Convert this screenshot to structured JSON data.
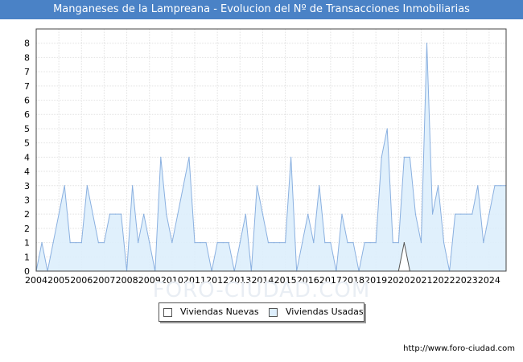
{
  "title": "Manganeses de la Lampreana - Evolucion del Nº de Transacciones Inmobiliarias",
  "watermark": "FORO-CIUDAD.COM",
  "footer_url": "http://www.foro-ciudad.com",
  "colors": {
    "title_bg": "#4a82c6",
    "usadas_fill": "#ddeefc",
    "usadas_line": "#8ab0e0",
    "nuevas_fill": "#ffffff",
    "nuevas_line": "#555555"
  },
  "legend": [
    {
      "label": "Viviendas Nuevas",
      "color": "#ffffff"
    },
    {
      "label": "Viviendas Usadas",
      "color": "#ddeefc"
    }
  ],
  "chart_data": {
    "type": "area",
    "title": "Manganeses de la Lampreana - Evolucion del Nº de Transacciones Inmobiliarias",
    "xlabel": "",
    "ylabel": "",
    "x_tick_labels": [
      "2004",
      "2005",
      "2006",
      "2007",
      "2008",
      "2009",
      "2010",
      "2011",
      "2012",
      "2013",
      "2014",
      "2015",
      "2016",
      "2017",
      "2018",
      "2019",
      "2020",
      "2021",
      "2022",
      "2023",
      "2024"
    ],
    "y_tick_labels": [
      "0",
      "1",
      "1",
      "2",
      "2",
      "3",
      "3",
      "4",
      "4",
      "5",
      "5",
      "6",
      "6",
      "7",
      "7",
      "8",
      "8"
    ],
    "ylim": [
      0,
      8.5
    ],
    "xlim": [
      2004.0,
      2024.75
    ],
    "grid": true,
    "legend_position": "bottom-center",
    "series": [
      {
        "name": "Viviendas Nuevas",
        "x": [
          2020.0,
          2020.25,
          2020.5
        ],
        "values": [
          0,
          1,
          0
        ]
      },
      {
        "name": "Viviendas Usadas",
        "x": [
          2004.0,
          2004.25,
          2004.5,
          2004.75,
          2005.0,
          2005.25,
          2005.5,
          2005.75,
          2006.0,
          2006.25,
          2006.5,
          2006.75,
          2007.0,
          2007.25,
          2007.5,
          2007.75,
          2008.0,
          2008.25,
          2008.5,
          2008.75,
          2009.0,
          2009.25,
          2009.5,
          2009.75,
          2010.0,
          2010.25,
          2010.5,
          2010.75,
          2011.0,
          2011.25,
          2011.5,
          2011.75,
          2012.0,
          2012.25,
          2012.5,
          2012.75,
          2013.0,
          2013.25,
          2013.5,
          2013.75,
          2014.0,
          2014.25,
          2014.5,
          2014.75,
          2015.0,
          2015.25,
          2015.5,
          2015.75,
          2016.0,
          2016.25,
          2016.5,
          2016.75,
          2017.0,
          2017.25,
          2017.5,
          2017.75,
          2018.0,
          2018.25,
          2018.5,
          2018.75,
          2019.0,
          2019.25,
          2019.5,
          2019.75,
          2020.0,
          2020.25,
          2020.5,
          2020.75,
          2021.0,
          2021.25,
          2021.5,
          2021.75,
          2022.0,
          2022.25,
          2022.5,
          2022.75,
          2023.0,
          2023.25,
          2023.5,
          2023.75,
          2024.0,
          2024.25,
          2024.5,
          2024.75
        ],
        "values": [
          0,
          1,
          0,
          1,
          2,
          3,
          1,
          1,
          1,
          3,
          2,
          1,
          1,
          2,
          2,
          2,
          0,
          3,
          1,
          2,
          1,
          0,
          4,
          2,
          1,
          2,
          3,
          4,
          1,
          1,
          1,
          0,
          1,
          1,
          1,
          0,
          1,
          2,
          0,
          3,
          2,
          1,
          1,
          1,
          1,
          4,
          0,
          1,
          2,
          1,
          3,
          1,
          1,
          0,
          2,
          1,
          1,
          0,
          1,
          1,
          1,
          4,
          5,
          1,
          1,
          4,
          4,
          2,
          1,
          8,
          2,
          3,
          1,
          0,
          2,
          2,
          2,
          2,
          3,
          1,
          2,
          3,
          3,
          3
        ]
      }
    ]
  }
}
